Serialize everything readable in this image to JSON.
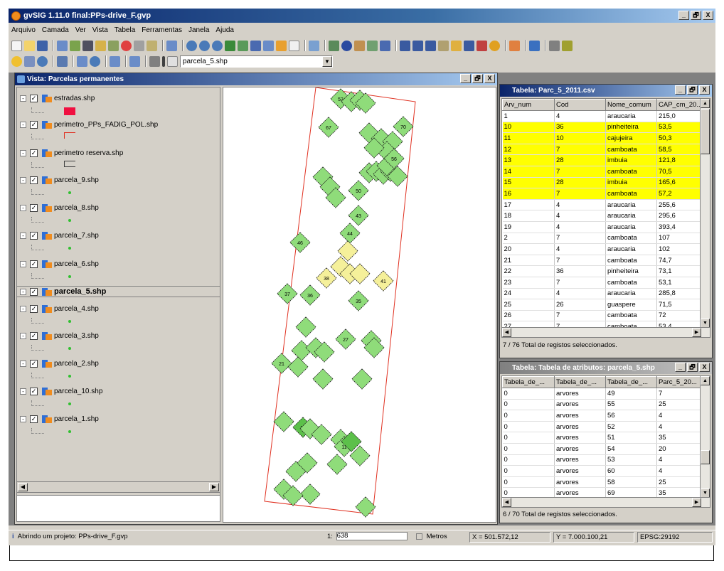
{
  "window": {
    "title": "gvSIG 1.11.0 final:PPs-drive_F.gvp",
    "min": "_",
    "max": "🗗",
    "close": "X"
  },
  "menu": [
    "Arquivo",
    "Camada",
    "Ver",
    "Vista",
    "Tabela",
    "Ferramentas",
    "Janela",
    "Ajuda"
  ],
  "toolbar": {
    "layer_combo_value": "parcela_5.shp"
  },
  "view": {
    "title": "Vista: Parcelas permanentes",
    "layers": [
      {
        "name": "estradas.shp",
        "legend": "red-fill",
        "checked": true
      },
      {
        "name": "perimetro_PPs_FADIG_POL.shp",
        "legend": "red-line",
        "checked": true
      },
      {
        "name": "perimetro reserva.shp",
        "legend": "gray-line",
        "checked": true
      },
      {
        "name": "parcela_9.shp",
        "legend": "green-dot",
        "checked": true
      },
      {
        "name": "parcela_8.shp",
        "legend": "green-dot",
        "checked": true
      },
      {
        "name": "parcela_7.shp",
        "legend": "green-dot",
        "checked": true
      },
      {
        "name": "parcela_6.shp",
        "legend": "green-dot",
        "checked": true
      },
      {
        "name": "parcela_5.shp",
        "legend": "",
        "checked": true,
        "active": true
      },
      {
        "name": "parcela_4.shp",
        "legend": "green-dot",
        "checked": true
      },
      {
        "name": "parcela_3.shp",
        "legend": "green-dot",
        "checked": true
      },
      {
        "name": "parcela_2.shp",
        "legend": "green-dot",
        "checked": true
      },
      {
        "name": "parcela_10.shp",
        "legend": "green-dot",
        "checked": true
      },
      {
        "name": "parcela_1.shp",
        "legend": "green-dot",
        "checked": true
      }
    ]
  },
  "map": {
    "trees": [
      {
        "l": "53",
        "c": "g"
      },
      {
        "l": "",
        "c": "g"
      },
      {
        "l": "",
        "c": "g"
      },
      {
        "l": "",
        "c": "g"
      },
      {
        "l": "67",
        "c": "g"
      },
      {
        "l": "",
        "c": "g"
      },
      {
        "l": "",
        "c": "g"
      },
      {
        "l": "",
        "c": "g"
      },
      {
        "l": "70",
        "c": "g"
      },
      {
        "l": "",
        "c": "g"
      },
      {
        "l": "",
        "c": "g"
      },
      {
        "l": "",
        "c": "g"
      },
      {
        "l": "",
        "c": "g"
      },
      {
        "l": "",
        "c": "g"
      },
      {
        "l": "",
        "c": "g"
      },
      {
        "l": "",
        "c": "g"
      },
      {
        "l": "",
        "c": "g"
      },
      {
        "l": "56",
        "c": "g"
      },
      {
        "l": "",
        "c": "g"
      },
      {
        "l": "",
        "c": "g"
      },
      {
        "l": "",
        "c": "g"
      },
      {
        "l": "50",
        "c": "g"
      },
      {
        "l": "43",
        "c": "g"
      },
      {
        "l": "44",
        "c": "g"
      },
      {
        "l": "46",
        "c": "g"
      },
      {
        "l": "",
        "c": "y"
      },
      {
        "l": "",
        "c": "y"
      },
      {
        "l": "",
        "c": "y"
      },
      {
        "l": "",
        "c": "y"
      },
      {
        "l": "38",
        "c": "y"
      },
      {
        "l": "41",
        "c": "y"
      },
      {
        "l": "37",
        "c": "g"
      },
      {
        "l": "36",
        "c": "g"
      },
      {
        "l": "35",
        "c": "g"
      },
      {
        "l": "",
        "c": "g"
      },
      {
        "l": "",
        "c": "g"
      },
      {
        "l": "",
        "c": "g"
      },
      {
        "l": "",
        "c": "g"
      },
      {
        "l": "27",
        "c": "g"
      },
      {
        "l": "",
        "c": "g"
      },
      {
        "l": "",
        "c": "g"
      },
      {
        "l": "21",
        "c": "g"
      },
      {
        "l": "",
        "c": "g"
      },
      {
        "l": "",
        "c": "g"
      },
      {
        "l": "",
        "c": "g"
      },
      {
        "l": "",
        "c": "g"
      },
      {
        "l": "14",
        "c": "dg"
      },
      {
        "l": "",
        "c": "g"
      },
      {
        "l": "",
        "c": "g"
      },
      {
        "l": "",
        "c": "g"
      },
      {
        "l": "11",
        "c": "g"
      },
      {
        "l": "",
        "c": "dg"
      },
      {
        "l": "",
        "c": "g"
      },
      {
        "l": "",
        "c": "g"
      },
      {
        "l": "",
        "c": "g"
      },
      {
        "l": "",
        "c": "g"
      },
      {
        "l": "",
        "c": "g"
      },
      {
        "l": "",
        "c": "g"
      },
      {
        "l": "",
        "c": "g"
      },
      {
        "l": "",
        "c": "g"
      },
      {
        "l": "",
        "c": "g"
      }
    ]
  },
  "table1": {
    "title": "Tabela: Parc_5_2011.csv",
    "columns": [
      "Arv_num",
      "Cod",
      "Nome_comum",
      "CAP_cm_20..."
    ],
    "rows": [
      {
        "c": [
          "1",
          "4",
          "araucaria",
          "215,0"
        ],
        "sel": false
      },
      {
        "c": [
          "10",
          "36",
          "pinheiteira",
          "53,5"
        ],
        "sel": true
      },
      {
        "c": [
          "11",
          "10",
          "cajujeira",
          "50,3"
        ],
        "sel": true
      },
      {
        "c": [
          "12",
          "7",
          "camboata",
          "58,5"
        ],
        "sel": true
      },
      {
        "c": [
          "13",
          "28",
          "imbuia",
          "121,8"
        ],
        "sel": true
      },
      {
        "c": [
          "14",
          "7",
          "camboata",
          "70,5"
        ],
        "sel": true
      },
      {
        "c": [
          "15",
          "28",
          "imbuia",
          "165,6"
        ],
        "sel": true
      },
      {
        "c": [
          "16",
          "7",
          "camboata",
          "57,2"
        ],
        "sel": true
      },
      {
        "c": [
          "17",
          "4",
          "araucaria",
          "255,6"
        ],
        "sel": false
      },
      {
        "c": [
          "18",
          "4",
          "araucaria",
          "295,6"
        ],
        "sel": false
      },
      {
        "c": [
          "19",
          "4",
          "araucaria",
          "393,4"
        ],
        "sel": false
      },
      {
        "c": [
          "2",
          "7",
          "camboata",
          "107"
        ],
        "sel": false
      },
      {
        "c": [
          "20",
          "4",
          "araucaria",
          "102"
        ],
        "sel": false
      },
      {
        "c": [
          "21",
          "7",
          "camboata",
          "74,7"
        ],
        "sel": false
      },
      {
        "c": [
          "22",
          "36",
          "pinheiteira",
          "73,1"
        ],
        "sel": false
      },
      {
        "c": [
          "23",
          "7",
          "camboata",
          "53,1"
        ],
        "sel": false
      },
      {
        "c": [
          "24",
          "4",
          "araucaria",
          "285,8"
        ],
        "sel": false
      },
      {
        "c": [
          "25",
          "26",
          "guaspere",
          "71,5"
        ],
        "sel": false
      },
      {
        "c": [
          "26",
          "7",
          "camboata",
          "72"
        ],
        "sel": false
      },
      {
        "c": [
          "27",
          "7",
          "camboata",
          "53,4"
        ],
        "sel": false
      }
    ],
    "status": "7 / 76 Total de registos seleccionados."
  },
  "table2": {
    "title": "Tabela: Tabela de atributos: parcela_5.shp",
    "columns": [
      "Tabela_de_...",
      "Tabela_de_...",
      "Tabela_de_...",
      "Parc_5_20..."
    ],
    "rows": [
      [
        "0",
        "arvores",
        "49",
        "7"
      ],
      [
        "0",
        "arvores",
        "55",
        "25"
      ],
      [
        "0",
        "arvores",
        "56",
        "4"
      ],
      [
        "0",
        "arvores",
        "52",
        "4"
      ],
      [
        "0",
        "arvores",
        "51",
        "35"
      ],
      [
        "0",
        "arvores",
        "54",
        "20"
      ],
      [
        "0",
        "arvores",
        "53",
        "4"
      ],
      [
        "0",
        "arvores",
        "60",
        "4"
      ],
      [
        "0",
        "arvores",
        "58",
        "25"
      ],
      [
        "0",
        "arvores",
        "69",
        "35"
      ]
    ],
    "status": "6 / 70 Total de registos seleccionados."
  },
  "statusbar": {
    "message": "Abrindo um projeto: PPs-drive_F.gvp",
    "scale_label": "1:",
    "scale_value": "638",
    "units": "Metros",
    "x": "X = 501.572,12",
    "y": "Y = 7.000.100,21",
    "epsg": "EPSG:29192"
  },
  "colors": {
    "selected_row": "#ffff00",
    "tree_green": "#8fdc7a",
    "tree_yellow": "#f5f09a",
    "plot_border": "#e03020",
    "title_blue": "#0a246a"
  }
}
